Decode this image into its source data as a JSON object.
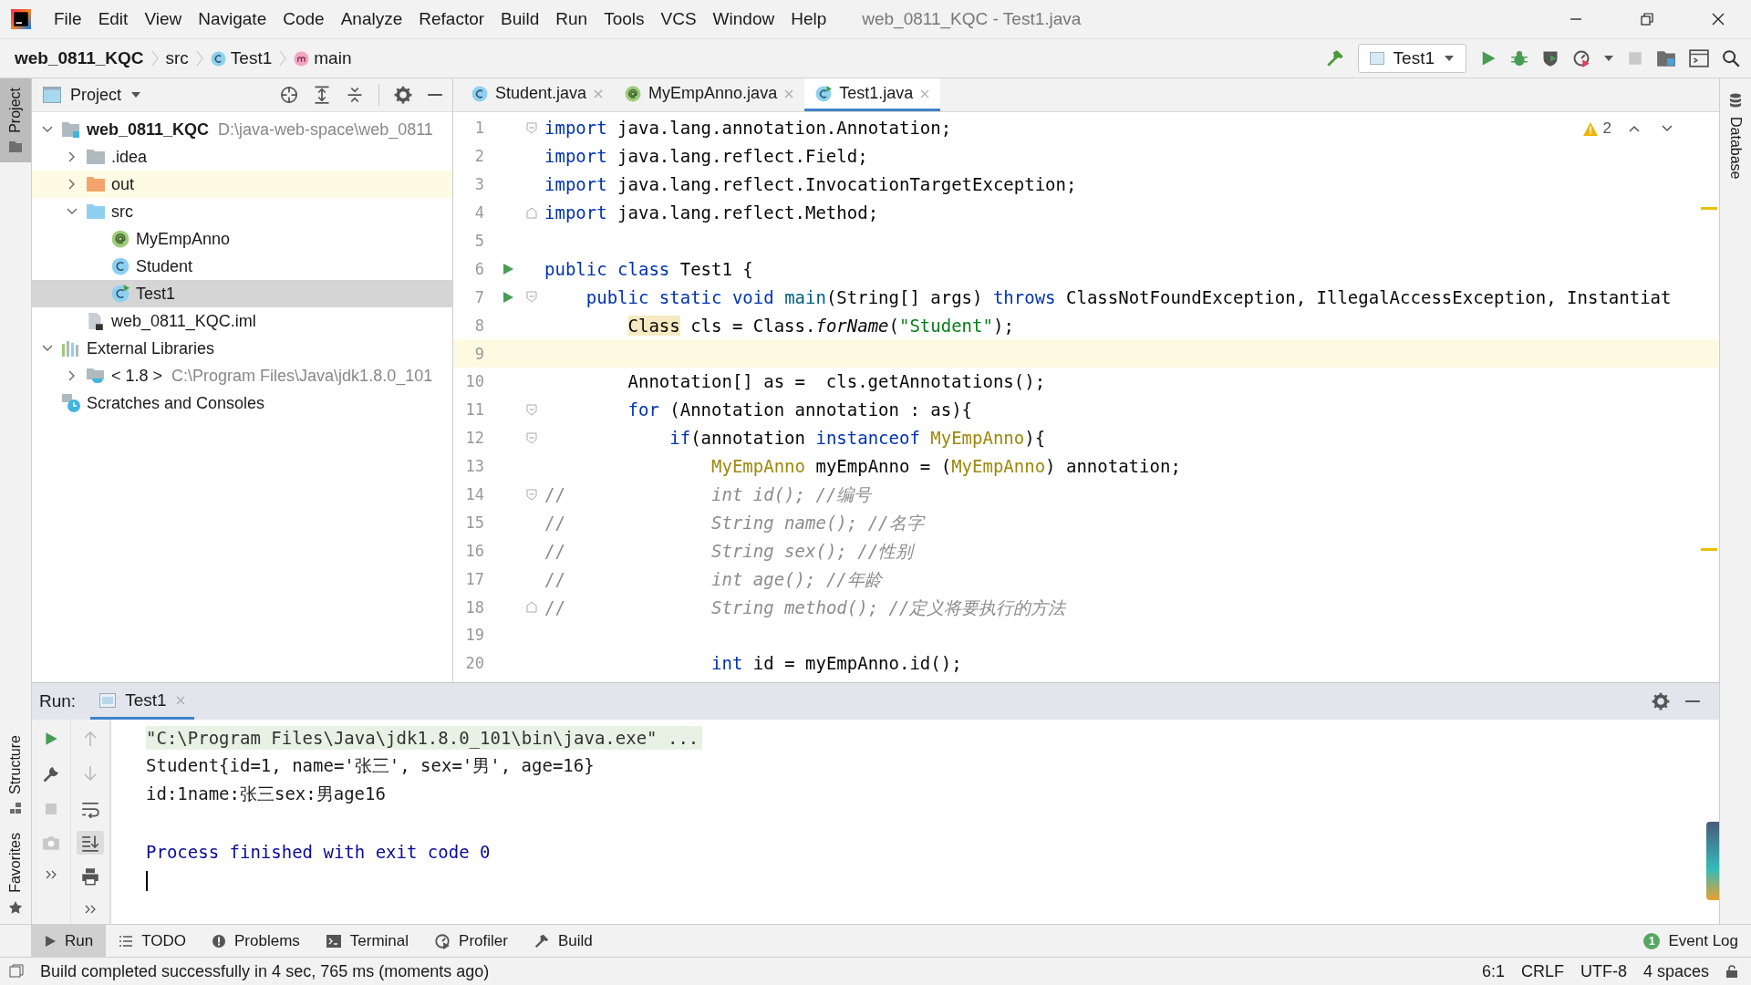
{
  "window": {
    "title": "web_0811_KQC - Test1.java"
  },
  "menu": [
    "File",
    "Edit",
    "View",
    "Navigate",
    "Code",
    "Analyze",
    "Refactor",
    "Build",
    "Run",
    "Tools",
    "VCS",
    "Window",
    "Help"
  ],
  "breadcrumbs": [
    {
      "label": "web_0811_KQC",
      "kind": "project"
    },
    {
      "label": "src",
      "kind": "folder"
    },
    {
      "label": "Test1",
      "kind": "class"
    },
    {
      "label": "main",
      "kind": "method"
    }
  ],
  "run_config": "Test1",
  "left_stripe": {
    "top": [
      {
        "label": "Project",
        "selected": true
      }
    ],
    "bottom": [
      {
        "label": "Structure",
        "selected": false
      },
      {
        "label": "Favorites",
        "selected": false
      }
    ]
  },
  "right_stripe": [
    {
      "label": "Database",
      "selected": false
    }
  ],
  "project": {
    "title": "Project",
    "tree": [
      {
        "label": "web_0811_KQC",
        "path": "D:\\java-web-space\\web_0811",
        "kind": "module",
        "expanded": true,
        "selected": false,
        "highlighted": false,
        "children": [
          {
            "label": ".idea",
            "kind": "folder",
            "expanded": false,
            "selected": false,
            "highlighted": false
          },
          {
            "label": "out",
            "kind": "folder-out",
            "expanded": false,
            "selected": false,
            "highlighted": true
          },
          {
            "label": "src",
            "kind": "folder-src",
            "expanded": true,
            "selected": false,
            "highlighted": false,
            "children": [
              {
                "label": "MyEmpAnno",
                "kind": "annotation",
                "selected": false,
                "highlighted": false
              },
              {
                "label": "Student",
                "kind": "class",
                "selected": false,
                "highlighted": false
              },
              {
                "label": "Test1",
                "kind": "class-run",
                "selected": true,
                "highlighted": false
              }
            ]
          },
          {
            "label": "web_0811_KQC.iml",
            "kind": "file",
            "selected": false,
            "highlighted": false
          }
        ]
      },
      {
        "label": "External Libraries",
        "kind": "libraries",
        "expanded": true,
        "selected": false,
        "highlighted": false,
        "children": [
          {
            "label": "< 1.8 >",
            "path": "C:\\Program Files\\Java\\jdk1.8.0_101",
            "kind": "jdk",
            "expanded": false,
            "selected": false,
            "highlighted": false
          }
        ]
      },
      {
        "label": "Scratches and Consoles",
        "kind": "scratches",
        "selected": false,
        "highlighted": false
      }
    ]
  },
  "editor": {
    "tabs": [
      {
        "label": "Student.java",
        "kind": "class",
        "selected": false
      },
      {
        "label": "MyEmpAnno.java",
        "kind": "annotation",
        "selected": false
      },
      {
        "label": "Test1.java",
        "kind": "class-run",
        "selected": true
      }
    ],
    "warnings": "2",
    "lines": [
      {
        "number": "1",
        "run": false,
        "current": false,
        "kind": "fold-start",
        "tokens": [
          {
            "text": "import",
            "kind": "kw"
          },
          {
            "text": " java.lang.annotation.Annotation;",
            "kind": "plain"
          }
        ]
      },
      {
        "number": "2",
        "run": false,
        "current": false,
        "tokens": [
          {
            "text": "import",
            "kind": "kw"
          },
          {
            "text": " java.lang.reflect.Field;",
            "kind": "plain"
          }
        ]
      },
      {
        "number": "3",
        "run": false,
        "current": false,
        "tokens": [
          {
            "text": "import",
            "kind": "kw"
          },
          {
            "text": " java.lang.reflect.InvocationTargetException;",
            "kind": "plain"
          }
        ]
      },
      {
        "number": "4",
        "run": false,
        "current": false,
        "kind": "fold-end",
        "tokens": [
          {
            "text": "import",
            "kind": "kw"
          },
          {
            "text": " java.lang.reflect.Method;",
            "kind": "plain"
          }
        ]
      },
      {
        "number": "5",
        "run": false,
        "current": false
      },
      {
        "number": "6",
        "run": true,
        "current": false,
        "tokens": [
          {
            "text": "public class",
            "kind": "kw"
          },
          {
            "text": " Test1 {",
            "kind": "plain"
          }
        ]
      },
      {
        "number": "7",
        "run": true,
        "current": false,
        "kind": "fold-start",
        "tokens": [
          {
            "text": "    public static void",
            "kind": "kw"
          },
          {
            "text": " main",
            "kind": "decl"
          },
          {
            "text": "(String[] args) ",
            "kind": "plain"
          },
          {
            "text": "throws",
            "kind": "kw"
          },
          {
            "text": " ClassNotFoundException, IllegalAccessException, Instantiat",
            "kind": "plain"
          }
        ]
      },
      {
        "number": "8",
        "run": false,
        "current": false,
        "tokens": [
          {
            "text": "        Class",
            "kind": "mark"
          },
          {
            "text": " cls = Class.",
            "kind": "plain"
          },
          {
            "text": "forName",
            "kind": "italic"
          },
          {
            "text": "(",
            "kind": "plain"
          },
          {
            "text": "\"Student\"",
            "kind": "str"
          },
          {
            "text": ");",
            "kind": "plain"
          }
        ]
      },
      {
        "number": "9",
        "run": false,
        "current": true
      },
      {
        "number": "10",
        "run": false,
        "current": false,
        "tokens": [
          {
            "text": "        Annotation[] as =  cls.getAnnotations();",
            "kind": "plain"
          }
        ]
      },
      {
        "number": "11",
        "run": false,
        "current": false,
        "kind": "fold-start",
        "tokens": [
          {
            "text": "        for",
            "kind": "kw"
          },
          {
            "text": " (Annotation annotation : as){",
            "kind": "plain"
          }
        ]
      },
      {
        "number": "12",
        "run": false,
        "current": false,
        "kind": "fold-start",
        "tokens": [
          {
            "text": "            if",
            "kind": "kw"
          },
          {
            "text": "(annotation ",
            "kind": "plain"
          },
          {
            "text": "instanceof",
            "kind": "kw"
          },
          {
            "text": " MyEmpAnno",
            "kind": "anno"
          },
          {
            "text": "){",
            "kind": "plain"
          }
        ]
      },
      {
        "number": "13",
        "run": false,
        "current": false,
        "tokens": [
          {
            "text": "                MyEmpAnno",
            "kind": "anno"
          },
          {
            "text": " myEmpAnno = (",
            "kind": "plain"
          },
          {
            "text": "MyEmpAnno",
            "kind": "anno"
          },
          {
            "text": ") annotation;",
            "kind": "plain"
          }
        ]
      },
      {
        "number": "14",
        "run": false,
        "current": false,
        "kind": "fold-start",
        "tokens": [
          {
            "text": "//",
            "kind": "cmt"
          },
          {
            "text": "              int id(); //编号",
            "kind": "cmt-i"
          }
        ]
      },
      {
        "number": "15",
        "run": false,
        "current": false,
        "tokens": [
          {
            "text": "//",
            "kind": "cmt"
          },
          {
            "text": "              String name(); //名字",
            "kind": "cmt-i"
          }
        ]
      },
      {
        "number": "16",
        "run": false,
        "current": false,
        "tokens": [
          {
            "text": "//",
            "kind": "cmt"
          },
          {
            "text": "              String sex(); //性别",
            "kind": "cmt-i"
          }
        ]
      },
      {
        "number": "17",
        "run": false,
        "current": false,
        "tokens": [
          {
            "text": "//",
            "kind": "cmt"
          },
          {
            "text": "              int age(); //年龄",
            "kind": "cmt-i"
          }
        ]
      },
      {
        "number": "18",
        "run": false,
        "current": false,
        "kind": "fold-end",
        "tokens": [
          {
            "text": "//",
            "kind": "cmt"
          },
          {
            "text": "              String method(); //定义将要执行的方法",
            "kind": "cmt-i"
          }
        ]
      },
      {
        "number": "19",
        "run": false,
        "current": false
      },
      {
        "number": "20",
        "run": false,
        "current": false,
        "tokens": [
          {
            "text": "                int",
            "kind": "kw"
          },
          {
            "text": " id = myEmpAnno.id();",
            "kind": "plain"
          }
        ]
      }
    ]
  },
  "run_panel": {
    "label": "Run:",
    "tabs": [
      {
        "label": "Test1",
        "selected": true
      }
    ],
    "output": [
      {
        "text": "\"C:\\Program Files\\Java\\jdk1.8.0_101\\bin\\java.exe\" ...",
        "kind": "command"
      },
      {
        "text": "Student{id=1, name='张三', sex='男', age=16}",
        "kind": "plain"
      },
      {
        "text": "id:1name:张三sex:男age16",
        "kind": "plain"
      },
      {
        "kind": "blank"
      },
      {
        "text": "Process finished with exit code 0",
        "kind": "info"
      }
    ],
    "caret": true
  },
  "tool_tabs": [
    {
      "label": "Run",
      "kind": "play",
      "selected": true
    },
    {
      "label": "TODO",
      "kind": "list",
      "selected": false
    },
    {
      "label": "Problems",
      "kind": "problems",
      "selected": false
    },
    {
      "label": "Terminal",
      "kind": "terminal",
      "selected": false
    },
    {
      "label": "Profiler",
      "kind": "profiler",
      "selected": false
    },
    {
      "label": "Build",
      "kind": "hammer",
      "selected": false
    }
  ],
  "event_log": {
    "label": "Event Log",
    "count": "1"
  },
  "status_bar": {
    "message": "Build completed successfully in 4 sec, 765 ms (moments ago)",
    "items": [
      "6:1",
      "CRLF",
      "UTF-8",
      "4 spaces"
    ]
  }
}
